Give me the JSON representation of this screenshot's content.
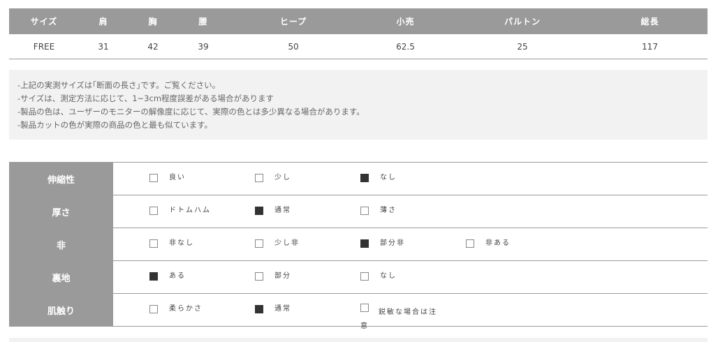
{
  "size_table": {
    "headers": [
      "サイズ",
      "肩",
      "胸",
      "腰",
      "ヒープ",
      "小売",
      "パルトン",
      "総長"
    ],
    "row": [
      "FREE",
      "31",
      "42",
      "39",
      "50",
      "62.5",
      "25",
      "117"
    ]
  },
  "notes": [
    "-上記の実測サイズは｢断面の長さ｣です。ご覧ください。",
    "-サイズは、測定方法に応じて、1~3cm程度誤差がある場合があります",
    "-製品の色は、ユーザーのモニターの解像度に応じて、実際の色とは多少異なる場合があります。",
    "-製品カットの色が実際の商品の色と最も似ています。"
  ],
  "properties": [
    {
      "label": "伸縮性",
      "options": [
        {
          "label": "良い",
          "checked": false
        },
        {
          "label": "少し",
          "checked": false
        },
        {
          "label": "なし",
          "checked": true
        }
      ]
    },
    {
      "label": "厚さ",
      "options": [
        {
          "label": "ドトムハム",
          "checked": false
        },
        {
          "label": "通常",
          "checked": true
        },
        {
          "label": "薄さ",
          "checked": false
        }
      ]
    },
    {
      "label": "非",
      "options": [
        {
          "label": "非なし",
          "checked": false
        },
        {
          "label": "少し非",
          "checked": false
        },
        {
          "label": "部分非",
          "checked": true
        },
        {
          "label": "非ある",
          "checked": false
        }
      ]
    },
    {
      "label": "裏地",
      "options": [
        {
          "label": "ある",
          "checked": true
        },
        {
          "label": "部分",
          "checked": false
        },
        {
          "label": "なし",
          "checked": false
        }
      ]
    },
    {
      "label": "肌触り",
      "options": [
        {
          "label": "柔らかさ",
          "checked": false
        },
        {
          "label": "通常",
          "checked": true
        },
        {
          "label": "鋭敏な場合は注意",
          "checked": false
        }
      ]
    }
  ],
  "colors": {
    "header_bg": "#9a9a9a",
    "note_bg": "#f2f2f2",
    "checked": "#333333"
  }
}
